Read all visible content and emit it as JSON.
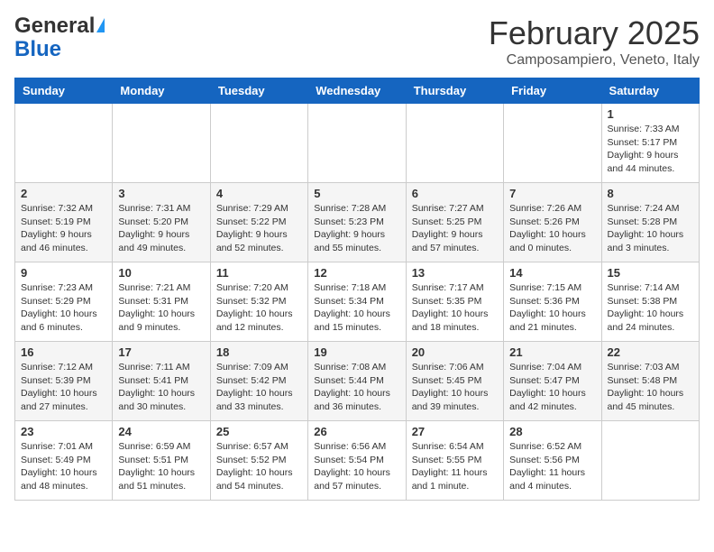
{
  "header": {
    "logo_general": "General",
    "logo_blue": "Blue",
    "month_title": "February 2025",
    "location": "Camposampiero, Veneto, Italy"
  },
  "weekdays": [
    "Sunday",
    "Monday",
    "Tuesday",
    "Wednesday",
    "Thursday",
    "Friday",
    "Saturday"
  ],
  "weeks": [
    [
      {
        "day": "",
        "info": ""
      },
      {
        "day": "",
        "info": ""
      },
      {
        "day": "",
        "info": ""
      },
      {
        "day": "",
        "info": ""
      },
      {
        "day": "",
        "info": ""
      },
      {
        "day": "",
        "info": ""
      },
      {
        "day": "1",
        "info": "Sunrise: 7:33 AM\nSunset: 5:17 PM\nDaylight: 9 hours and 44 minutes."
      }
    ],
    [
      {
        "day": "2",
        "info": "Sunrise: 7:32 AM\nSunset: 5:19 PM\nDaylight: 9 hours and 46 minutes."
      },
      {
        "day": "3",
        "info": "Sunrise: 7:31 AM\nSunset: 5:20 PM\nDaylight: 9 hours and 49 minutes."
      },
      {
        "day": "4",
        "info": "Sunrise: 7:29 AM\nSunset: 5:22 PM\nDaylight: 9 hours and 52 minutes."
      },
      {
        "day": "5",
        "info": "Sunrise: 7:28 AM\nSunset: 5:23 PM\nDaylight: 9 hours and 55 minutes."
      },
      {
        "day": "6",
        "info": "Sunrise: 7:27 AM\nSunset: 5:25 PM\nDaylight: 9 hours and 57 minutes."
      },
      {
        "day": "7",
        "info": "Sunrise: 7:26 AM\nSunset: 5:26 PM\nDaylight: 10 hours and 0 minutes."
      },
      {
        "day": "8",
        "info": "Sunrise: 7:24 AM\nSunset: 5:28 PM\nDaylight: 10 hours and 3 minutes."
      }
    ],
    [
      {
        "day": "9",
        "info": "Sunrise: 7:23 AM\nSunset: 5:29 PM\nDaylight: 10 hours and 6 minutes."
      },
      {
        "day": "10",
        "info": "Sunrise: 7:21 AM\nSunset: 5:31 PM\nDaylight: 10 hours and 9 minutes."
      },
      {
        "day": "11",
        "info": "Sunrise: 7:20 AM\nSunset: 5:32 PM\nDaylight: 10 hours and 12 minutes."
      },
      {
        "day": "12",
        "info": "Sunrise: 7:18 AM\nSunset: 5:34 PM\nDaylight: 10 hours and 15 minutes."
      },
      {
        "day": "13",
        "info": "Sunrise: 7:17 AM\nSunset: 5:35 PM\nDaylight: 10 hours and 18 minutes."
      },
      {
        "day": "14",
        "info": "Sunrise: 7:15 AM\nSunset: 5:36 PM\nDaylight: 10 hours and 21 minutes."
      },
      {
        "day": "15",
        "info": "Sunrise: 7:14 AM\nSunset: 5:38 PM\nDaylight: 10 hours and 24 minutes."
      }
    ],
    [
      {
        "day": "16",
        "info": "Sunrise: 7:12 AM\nSunset: 5:39 PM\nDaylight: 10 hours and 27 minutes."
      },
      {
        "day": "17",
        "info": "Sunrise: 7:11 AM\nSunset: 5:41 PM\nDaylight: 10 hours and 30 minutes."
      },
      {
        "day": "18",
        "info": "Sunrise: 7:09 AM\nSunset: 5:42 PM\nDaylight: 10 hours and 33 minutes."
      },
      {
        "day": "19",
        "info": "Sunrise: 7:08 AM\nSunset: 5:44 PM\nDaylight: 10 hours and 36 minutes."
      },
      {
        "day": "20",
        "info": "Sunrise: 7:06 AM\nSunset: 5:45 PM\nDaylight: 10 hours and 39 minutes."
      },
      {
        "day": "21",
        "info": "Sunrise: 7:04 AM\nSunset: 5:47 PM\nDaylight: 10 hours and 42 minutes."
      },
      {
        "day": "22",
        "info": "Sunrise: 7:03 AM\nSunset: 5:48 PM\nDaylight: 10 hours and 45 minutes."
      }
    ],
    [
      {
        "day": "23",
        "info": "Sunrise: 7:01 AM\nSunset: 5:49 PM\nDaylight: 10 hours and 48 minutes."
      },
      {
        "day": "24",
        "info": "Sunrise: 6:59 AM\nSunset: 5:51 PM\nDaylight: 10 hours and 51 minutes."
      },
      {
        "day": "25",
        "info": "Sunrise: 6:57 AM\nSunset: 5:52 PM\nDaylight: 10 hours and 54 minutes."
      },
      {
        "day": "26",
        "info": "Sunrise: 6:56 AM\nSunset: 5:54 PM\nDaylight: 10 hours and 57 minutes."
      },
      {
        "day": "27",
        "info": "Sunrise: 6:54 AM\nSunset: 5:55 PM\nDaylight: 11 hours and 1 minute."
      },
      {
        "day": "28",
        "info": "Sunrise: 6:52 AM\nSunset: 5:56 PM\nDaylight: 11 hours and 4 minutes."
      },
      {
        "day": "",
        "info": ""
      }
    ]
  ]
}
